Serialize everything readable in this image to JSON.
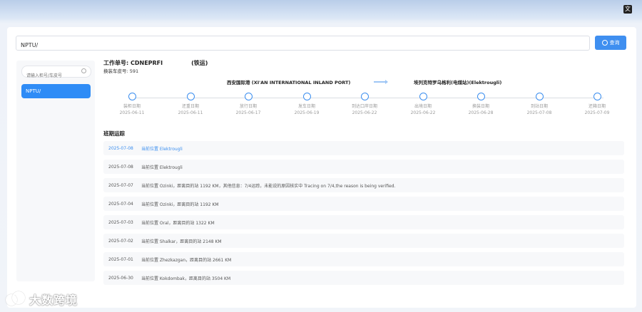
{
  "search": {
    "value": "NPTU/",
    "query_label": "查询"
  },
  "sidebar": {
    "search_placeholder": "请输入柜号/车皮号",
    "items": [
      {
        "label": "NPTU/"
      }
    ]
  },
  "header": {
    "order_label": "工作单号: ",
    "order_no": "CDNEPRFI",
    "transport_mode": "(铁运)",
    "car_label": "换装车皮号: ",
    "car_no": "591"
  },
  "route": {
    "from": "西安国际港 (XI'AN INTERNATIONAL INLAND PORT)",
    "to": "埃列克特罗乌格利(电煤站)(Elektrougli)"
  },
  "timeline": [
    {
      "label": "装柜日期",
      "date": "2025-06-11"
    },
    {
      "label": "还重日期",
      "date": "2025-06-11"
    },
    {
      "label": "放行日期",
      "date": "2025-06-17"
    },
    {
      "label": "发车日期",
      "date": "2025-06-19"
    },
    {
      "label": "到达口岸日期",
      "date": "2025-06-22"
    },
    {
      "label": "出境日期",
      "date": "2025-06-22"
    },
    {
      "label": "换装日期",
      "date": "2025-06-28"
    },
    {
      "label": "到站日期",
      "date": "2025-07-08"
    },
    {
      "label": "还箱日期",
      "date": "2025-07-09"
    }
  ],
  "tracking": {
    "title": "班期运踪",
    "rows": [
      {
        "date": "2025-07-08",
        "text": "当前位置 Elektrougli"
      },
      {
        "date": "2025-07-08",
        "text": "当前位置 Elektrougli"
      },
      {
        "date": "2025-07-07",
        "text": "当前位置 Ozinki，距离目的站 1192 KM，其他信息：7/4运踪，未能说的原因核实中 Tracing on 7/4,the reason is being verified."
      },
      {
        "date": "2025-07-04",
        "text": "当前位置 Ozinki，距离目的站 1192 KM"
      },
      {
        "date": "2025-07-03",
        "text": "当前位置 Oral，距离目的站 1322 KM"
      },
      {
        "date": "2025-07-02",
        "text": "当前位置 Shalkar，距离目的站 2148 KM"
      },
      {
        "date": "2025-07-01",
        "text": "当前位置 Zhezkazgan，距离目的站 2661 KM"
      },
      {
        "date": "2025-06-30",
        "text": "当前位置 Kokdombak，距离目的站 3504 KM"
      }
    ]
  },
  "watermark": {
    "text": "大数跨境"
  },
  "colors": {
    "accent": "#3b8eef",
    "button": "#3f8ff0",
    "sidebar_active": "#2f8cf6"
  }
}
